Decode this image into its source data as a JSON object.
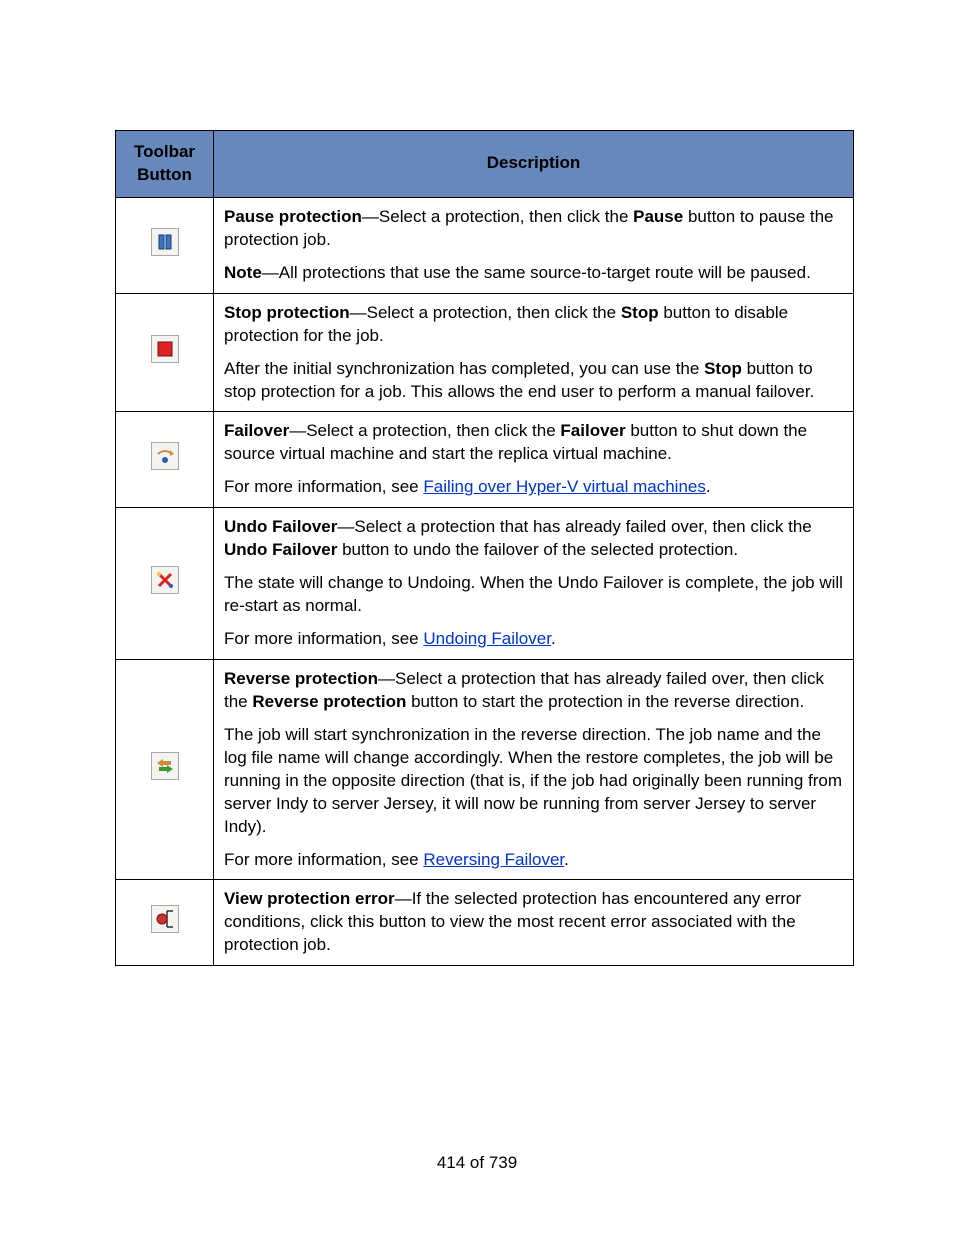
{
  "headers": {
    "col1": "Toolbar Button",
    "col2": "Description"
  },
  "rows": [
    {
      "icon": "pause",
      "para": [
        {
          "segments": [
            {
              "t": "Pause protection",
              "b": true
            },
            {
              "t": "—Select a protection, then click the "
            },
            {
              "t": "Pause",
              "b": true
            },
            {
              "t": " button to pause the protection job."
            }
          ]
        },
        {
          "segments": [
            {
              "t": "Note",
              "b": true
            },
            {
              "t": "—All protections that use the same source-to-target route will be paused."
            }
          ]
        }
      ]
    },
    {
      "icon": "stop",
      "para": [
        {
          "segments": [
            {
              "t": "Stop protection",
              "b": true
            },
            {
              "t": "—Select a protection, then click the "
            },
            {
              "t": "Stop",
              "b": true
            },
            {
              "t": " button to disable protection for the job."
            }
          ]
        },
        {
          "segments": [
            {
              "t": "After the initial synchronization has completed, you can use the "
            },
            {
              "t": "Stop",
              "b": true
            },
            {
              "t": " button to stop protection for a job. This allows the end user to perform a manual failover."
            }
          ]
        }
      ]
    },
    {
      "icon": "failover",
      "para": [
        {
          "segments": [
            {
              "t": "Failover",
              "b": true
            },
            {
              "t": "—Select a protection, then click the "
            },
            {
              "t": "Failover",
              "b": true
            },
            {
              "t": " button to shut down the source virtual machine and start the replica virtual machine."
            }
          ]
        },
        {
          "segments": [
            {
              "t": "For more information, see "
            },
            {
              "t": "Failing over Hyper-V virtual machines",
              "link": true
            },
            {
              "t": "."
            }
          ]
        }
      ]
    },
    {
      "icon": "undo",
      "para": [
        {
          "segments": [
            {
              "t": "Undo Failover",
              "b": true
            },
            {
              "t": "—Select a protection that has already failed over, then click the "
            },
            {
              "t": "Undo Failover",
              "b": true
            },
            {
              "t": " button to undo the failover of the selected protection."
            }
          ]
        },
        {
          "segments": [
            {
              "t": "The state will change to Undoing. When the Undo Failover is complete, the job will re-start as normal."
            }
          ]
        },
        {
          "segments": [
            {
              "t": "For more information, see "
            },
            {
              "t": "Undoing Failover",
              "link": true
            },
            {
              "t": "."
            }
          ]
        }
      ]
    },
    {
      "icon": "reverse",
      "para": [
        {
          "segments": [
            {
              "t": "Reverse protection",
              "b": true
            },
            {
              "t": "—Select a protection that has already failed over, then click the "
            },
            {
              "t": "Reverse protection",
              "b": true
            },
            {
              "t": " button to start the protection in the reverse direction."
            }
          ]
        },
        {
          "segments": [
            {
              "t": "The job will start synchronization in the reverse direction. The job name and the log file name will change accordingly. When the restore completes, the job will be running in the opposite direction (that is, if the job had originally been running from server Indy to server Jersey, it will now be running from server Jersey to server Indy)."
            }
          ]
        },
        {
          "segments": [
            {
              "t": "For more information, see "
            },
            {
              "t": "Reversing Failover",
              "link": true
            },
            {
              "t": "."
            }
          ]
        }
      ]
    },
    {
      "icon": "error",
      "para": [
        {
          "segments": [
            {
              "t": "View protection error",
              "b": true
            },
            {
              "t": "—If the selected protection has encountered any error conditions, click this button to view the most recent error associated with the protection job."
            }
          ]
        }
      ]
    }
  ],
  "footer": "414 of 739"
}
